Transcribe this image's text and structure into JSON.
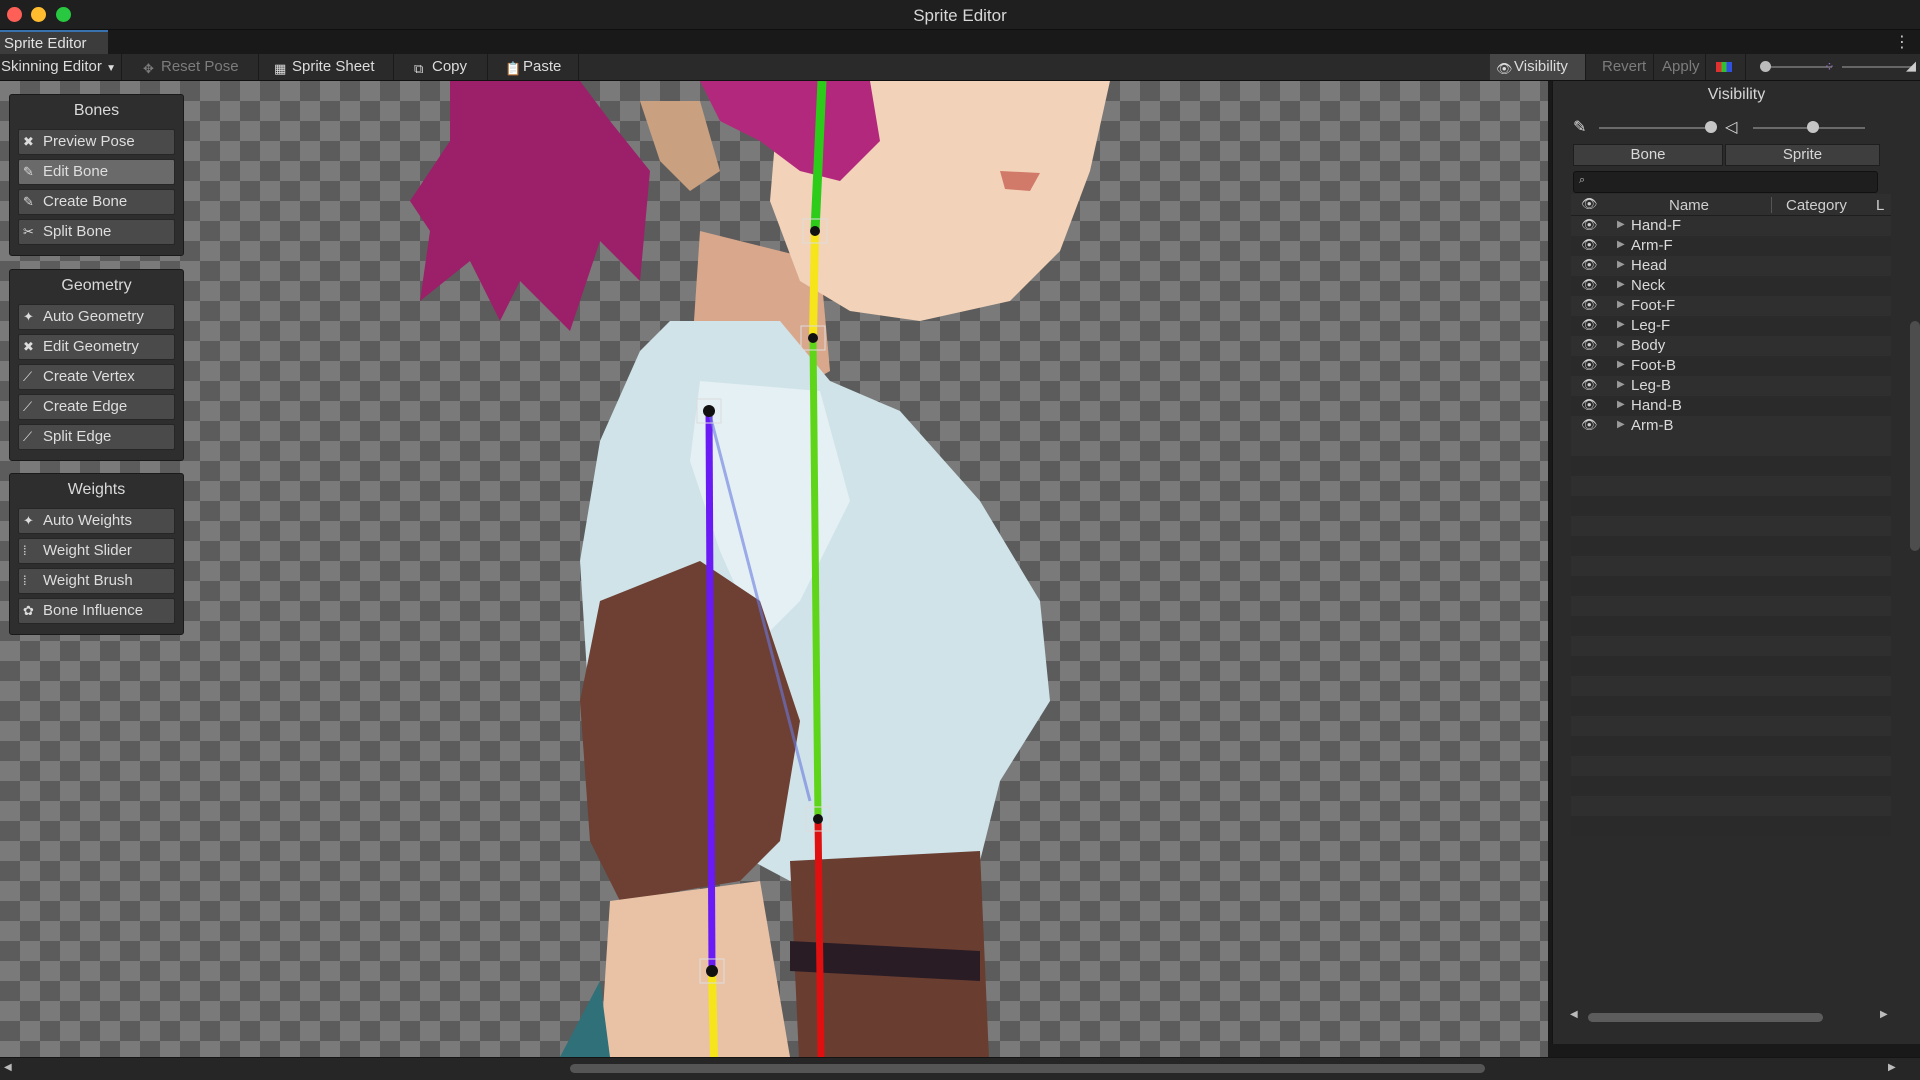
{
  "window": {
    "title": "Sprite Editor"
  },
  "tab": {
    "label": "Sprite Editor",
    "more_icon": "kebab-menu-icon"
  },
  "toolbar": {
    "mode_select": "Skinning Editor",
    "reset_pose": "Reset Pose",
    "sprite_sheet": "Sprite Sheet",
    "copy": "Copy",
    "paste": "Paste",
    "visibility": "Visibility",
    "revert": "Revert",
    "apply": "Apply"
  },
  "panels": {
    "bones": {
      "title": "Bones",
      "items": [
        "Preview Pose",
        "Edit Bone",
        "Create Bone",
        "Split Bone"
      ],
      "selected": "Edit Bone"
    },
    "geometry": {
      "title": "Geometry",
      "items": [
        "Auto Geometry",
        "Edit Geometry",
        "Create Vertex",
        "Create Edge",
        "Split Edge"
      ]
    },
    "weights": {
      "title": "Weights",
      "items": [
        "Auto Weights",
        "Weight Slider",
        "Weight Brush",
        "Bone Influence"
      ]
    }
  },
  "visibility_panel": {
    "title": "Visibility",
    "tabs": [
      "Bone",
      "Sprite"
    ],
    "search_placeholder": "",
    "columns": {
      "name": "Name",
      "category": "Category",
      "extra": "L"
    },
    "rows": [
      "Hand-F",
      "Arm-F",
      "Head",
      "Neck",
      "Foot-F",
      "Leg-F",
      "Body",
      "Foot-B",
      "Leg-B",
      "Hand-B",
      "Arm-B"
    ]
  },
  "colors": {
    "bone_green": "#2ecc1a",
    "bone_yellow": "#f5e51a",
    "bone_purple": "#6a1af5",
    "bone_red": "#e01010",
    "hair": "#a8206e",
    "shirt": "#cfe4ea",
    "sleeve": "#6e4034"
  }
}
